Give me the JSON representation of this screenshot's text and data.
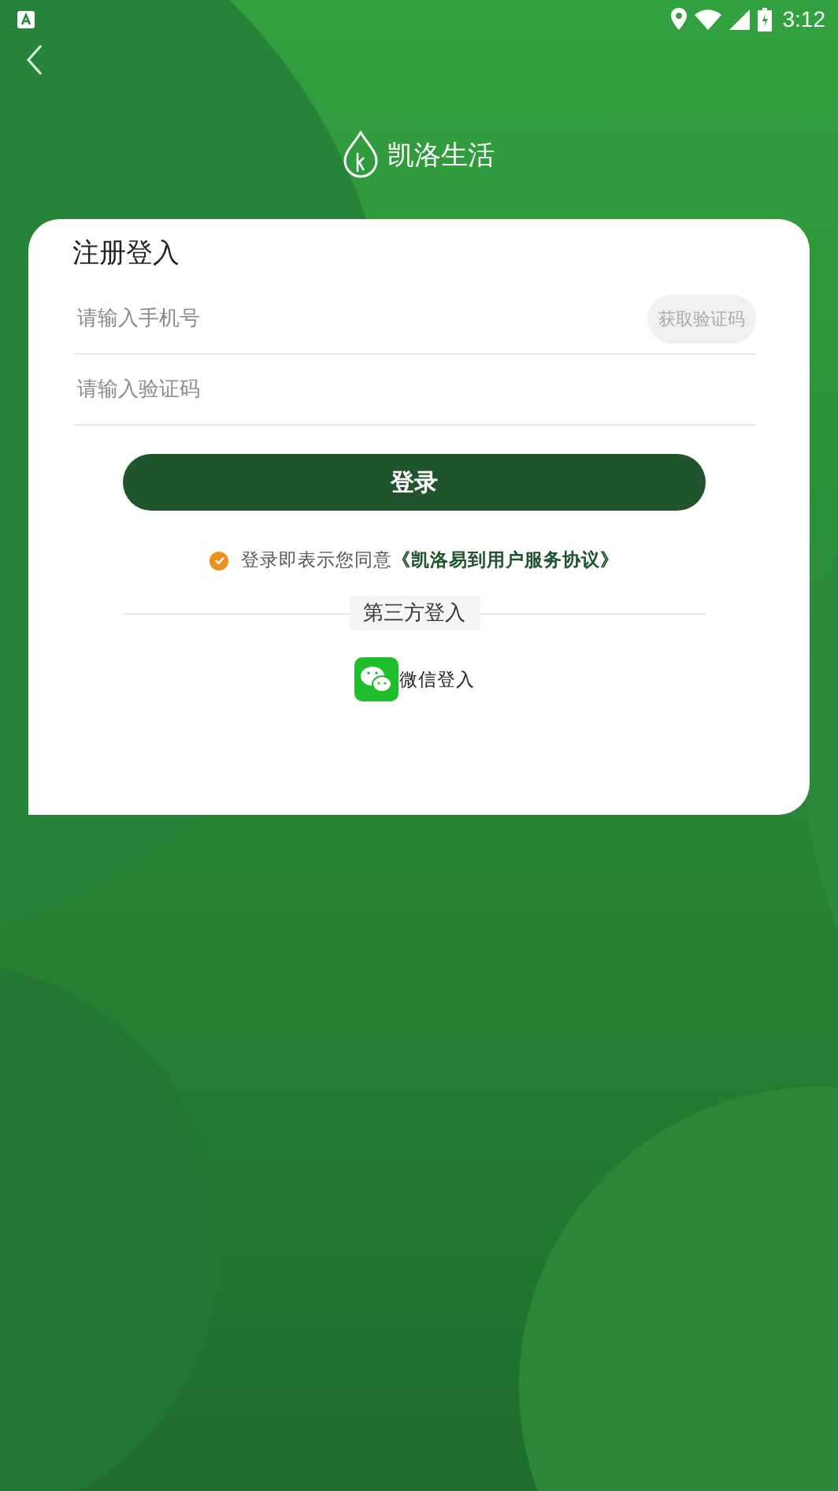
{
  "status_bar": {
    "time": "3:12"
  },
  "header": {
    "app_name": "凯洛生活"
  },
  "card": {
    "title": "注册登入",
    "fields": [
      {
        "placeholder": "请输入手机号",
        "action": {
          "label": "获取验证码",
          "disabled": true
        }
      },
      {
        "placeholder": "请输入验证码"
      }
    ],
    "login_button": "登录",
    "agreement": {
      "checked": true,
      "text": "登录即表示您同意",
      "link": "《凯洛易到用户服务协议》"
    },
    "third_party": {
      "heading": "第三方登入",
      "options": [
        {
          "label": "微信登入"
        }
      ]
    }
  }
}
